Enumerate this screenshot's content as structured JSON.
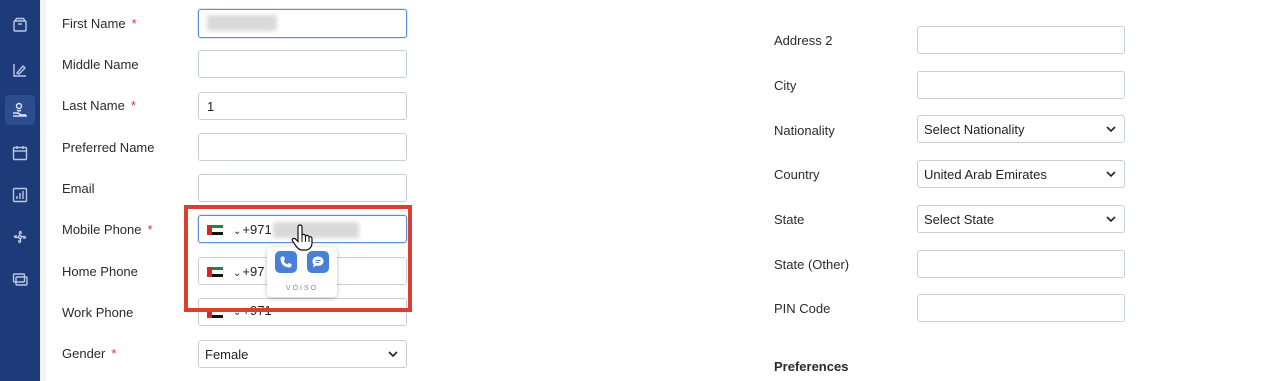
{
  "sidebar": {
    "icons": [
      "box-icon",
      "chart-edit-icon",
      "care-hand-icon",
      "calendar-icon",
      "report-chart-icon",
      "fan-icon",
      "cards-icon"
    ],
    "active_index": 2,
    "bg_color": "#1d3b78"
  },
  "left_form": {
    "first_name": {
      "label": "First Name",
      "required": true
    },
    "middle_name": {
      "label": "Middle Name",
      "value": ""
    },
    "last_name": {
      "label": "Last Name",
      "required": true,
      "value": "1"
    },
    "preferred_name": {
      "label": "Preferred Name",
      "value": ""
    },
    "email": {
      "label": "Email",
      "value": ""
    },
    "mobile_phone": {
      "label": "Mobile Phone",
      "required": true,
      "code": "+971"
    },
    "home_phone": {
      "label": "Home Phone",
      "code": "+97"
    },
    "work_phone": {
      "label": "Work Phone",
      "code": "+971"
    },
    "gender": {
      "label": "Gender",
      "required": true,
      "value": "Female"
    },
    "required_mark": "*"
  },
  "voiso_popup": {
    "brand": "VOISO",
    "call_icon": "phone-icon",
    "chat_icon": "chat-bubble-icon",
    "button_color": "#4a7fd8"
  },
  "highlight_color": "#d9402f",
  "right_form": {
    "address2": {
      "label": "Address 2",
      "value": ""
    },
    "city": {
      "label": "City",
      "value": ""
    },
    "nationality": {
      "label": "Nationality",
      "value": "Select Nationality"
    },
    "country": {
      "label": "Country",
      "value": "United Arab Emirates"
    },
    "state": {
      "label": "State",
      "value": "Select State"
    },
    "state_other": {
      "label": "State (Other)",
      "value": ""
    },
    "pin_code": {
      "label": "PIN Code",
      "value": ""
    },
    "preferences_title": "Preferences"
  }
}
